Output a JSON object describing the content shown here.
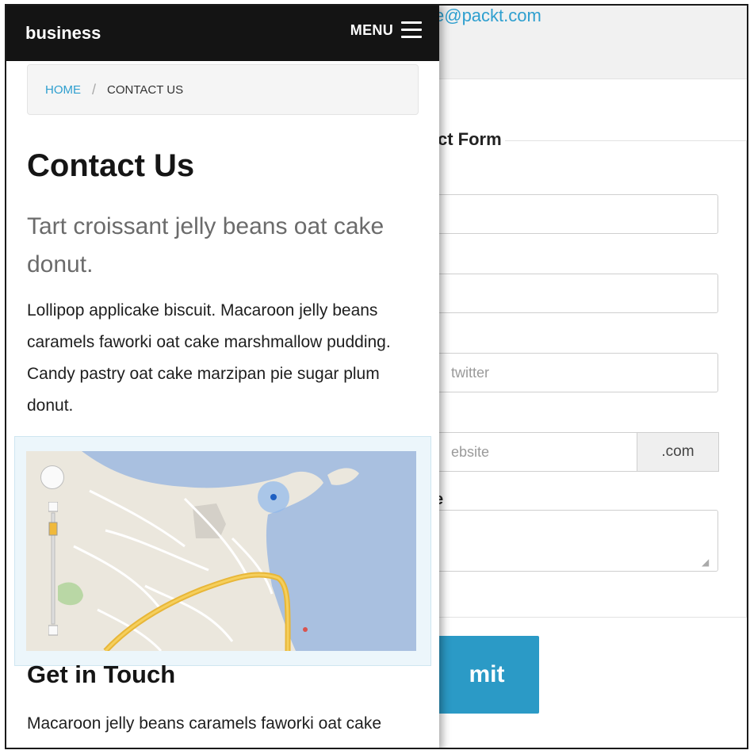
{
  "background_page": {
    "email_partial": "e@packt.com",
    "form_legend_partial": "ct Form",
    "fields": [
      {
        "placeholder": ""
      },
      {
        "placeholder": ""
      },
      {
        "placeholder": "twitter"
      },
      {
        "placeholder": "ebsite"
      }
    ],
    "website_addon": ".com",
    "message_label_partial": "e",
    "submit_label_partial": "mit",
    "colors": {
      "link": "#2e9fcf",
      "button": "#2b9ac6"
    }
  },
  "navbar": {
    "brand": "business",
    "menu_label": "MENU",
    "menu_icon": "hamburger-icon",
    "background": "#141414"
  },
  "breadcrumb": {
    "home": "HOME",
    "separator": "/",
    "current": "CONTACT US"
  },
  "main": {
    "title": "Contact Us",
    "lead": "Tart croissant jelly beans oat cake donut.",
    "body": "Lollipop applicake biscuit. Macaroon jelly beans caramels faworki oat cake marshmallow pudding. Candy pastry oat cake marzipan pie sugar plum donut."
  },
  "map": {
    "controls": [
      "pan-control-icon",
      "zoom-slider-icon"
    ]
  },
  "get_in_touch": {
    "title": "Get in Touch",
    "text": "Macaroon jelly beans caramels faworki oat cake marshmallow pudding. Candy pastry"
  }
}
